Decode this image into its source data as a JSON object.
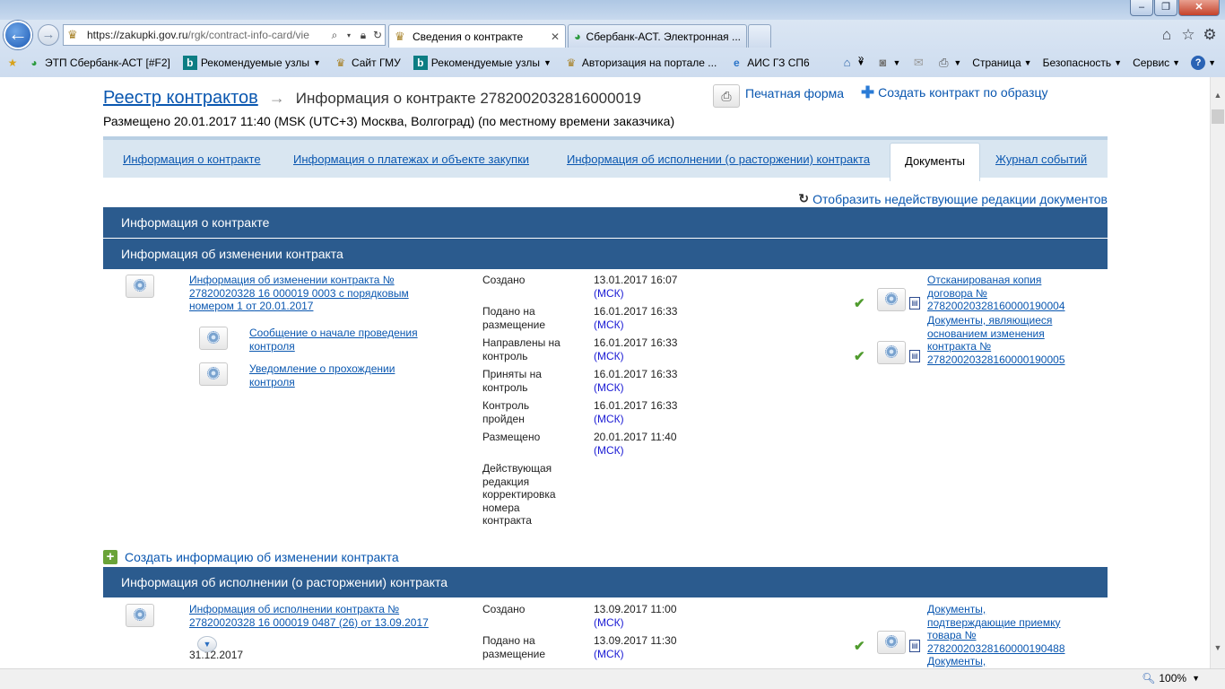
{
  "browser": {
    "address_url_host": "https://zakupki.gov.ru",
    "address_url_path": "/rgk/contract-info-card/vie",
    "tabs": [
      {
        "label": "Сведения о контракте",
        "active": true
      },
      {
        "label": "Сбербанк-АСТ. Электронная ...",
        "active": false
      }
    ],
    "favorites": [
      {
        "label": "ЭТП Сбербанк-АСТ [#F2]",
        "dropdown": false
      },
      {
        "label": "Рекомендуемые узлы",
        "dropdown": true
      },
      {
        "label": "Сайт ГМУ",
        "dropdown": false
      },
      {
        "label": "Рекомендуемые узлы",
        "dropdown": true
      },
      {
        "label": "Авторизация на портале ...",
        "dropdown": false
      },
      {
        "label": "АИС ГЗ СП6",
        "dropdown": false
      }
    ],
    "favorites_overflow": "»",
    "commands": {
      "page": "Страница",
      "safety": "Безопасность",
      "tools": "Сервис"
    },
    "zoom": "100%"
  },
  "header": {
    "registry_link": "Реестр контрактов",
    "arrow": "→",
    "title": "Информация о контракте 2782002032816000019",
    "posted": "Размещено 20.01.2017 11:40 (MSK (UTC+3) Москва, Волгоград) (по местному времени заказчика)",
    "print_form": "Печатная форма",
    "create_by_template": "Создать контракт по образцу"
  },
  "tabs": [
    {
      "label": "Информация о контракте",
      "selected": false
    },
    {
      "label": "Информация о платежах и объекте закупки",
      "selected": false
    },
    {
      "label": "Информация об исполнении (о расторжении) контракта",
      "selected": false
    },
    {
      "label": "Документы",
      "selected": true
    },
    {
      "label": "Журнал событий",
      "selected": false
    }
  ],
  "show_inactive": "Отобразить недействующие редакции документов",
  "sections": {
    "contract_info": "Информация о контракте",
    "change_info": "Информация об изменении контракта",
    "execution_info": "Информация об исполнении (о расторжении) контракта"
  },
  "change_record": {
    "main_link": "Информация об изменении контракта № 27820020328 16 000019 0003 с порядковым номером 1 от 20.01.2017",
    "sub_links": [
      "Сообщение о начале проведения контроля",
      "Уведомление о прохождении контроля"
    ],
    "events": [
      {
        "label": "Создано",
        "date": "13.01.2017 16:07",
        "tz": "(МСК)"
      },
      {
        "label": "Подано на размещение",
        "date": "16.01.2017 16:33",
        "tz": "(МСК)"
      },
      {
        "label": "Направлены на контроль",
        "date": "16.01.2017 16:33",
        "tz": "(МСК)"
      },
      {
        "label": "Приняты на контроль",
        "date": "16.01.2017 16:33",
        "tz": "(МСК)"
      },
      {
        "label": "Контроль пройден",
        "date": "16.01.2017 16:33",
        "tz": "(МСК)"
      },
      {
        "label": "Размещено",
        "date": "20.01.2017 11:40",
        "tz": "(МСК)"
      },
      {
        "label": "Действующая редакция корректировка номера контракта",
        "date": "",
        "tz": ""
      }
    ],
    "documents": [
      "Отсканированая копия договора № 27820020328160000190004",
      "Документы, являющиеся основанием изменения контракта № 27820020328160000190005"
    ]
  },
  "create_change": "Создать информацию об изменении контракта",
  "execution_record": {
    "main_link": "Информация об исполнении контракта № 27820020328 16 000019 0487 (26) от 13.09.2017",
    "date_below": "31.12.2017",
    "events": [
      {
        "label": "Создано",
        "date": "13.09.2017 11:00",
        "tz": "(МСК)"
      },
      {
        "label": "Подано на размещение",
        "date": "13.09.2017 11:30",
        "tz": "(МСК)"
      }
    ],
    "documents": [
      "Документы, подтверждающие приемку товара № 27820020328160000190488",
      "Документы,"
    ]
  }
}
